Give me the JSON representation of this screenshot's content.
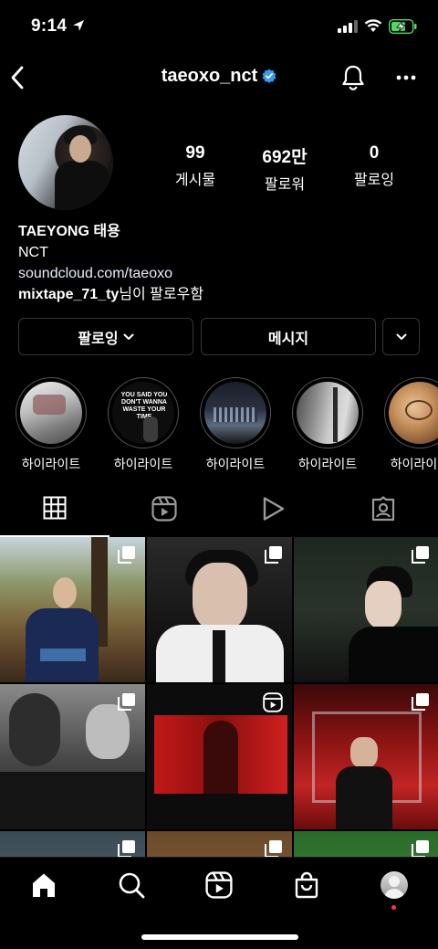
{
  "status": {
    "time": "9:14"
  },
  "header": {
    "username": "taeoxo_nct"
  },
  "stats": [
    {
      "value": "99",
      "label": "게시물"
    },
    {
      "value": "692만",
      "label": "팔로워"
    },
    {
      "value": "0",
      "label": "팔로잉"
    }
  ],
  "bio": {
    "name": "TAEYONG 태용",
    "line2": "NCT",
    "link": "soundcloud.com/taeoxo",
    "followed_user": "mixtape_71_ty",
    "followed_suffix": "님이 팔로우함"
  },
  "buttons": {
    "following": "팔로잉",
    "message": "메시지"
  },
  "highlights": [
    {
      "label": "하이라이트",
      "text": ""
    },
    {
      "label": "하이라이트",
      "text": "YOU SAID YOU DON'T WANNA WASTE YOUR TIME"
    },
    {
      "label": "하이라이트",
      "text": ""
    },
    {
      "label": "하이라이트",
      "text": ""
    },
    {
      "label": "하이라이트",
      "text": ""
    }
  ],
  "tabs": [
    {
      "icon": "grid-icon",
      "active": true
    },
    {
      "icon": "reels-icon",
      "active": false
    },
    {
      "icon": "play-icon",
      "active": false
    },
    {
      "icon": "tagged-icon",
      "active": false
    }
  ],
  "posts": [
    {
      "type": "carousel",
      "tone": "autumn-park"
    },
    {
      "type": "carousel",
      "tone": "dark-portrait"
    },
    {
      "type": "carousel",
      "tone": "dark-night"
    },
    {
      "type": "carousel",
      "tone": "bw-duo"
    },
    {
      "type": "reel",
      "tone": "red-screen"
    },
    {
      "type": "carousel",
      "tone": "red-stage"
    },
    {
      "type": "carousel",
      "tone": "gray"
    },
    {
      "type": "carousel",
      "tone": "warm"
    },
    {
      "type": "carousel",
      "tone": "green"
    }
  ],
  "nav": [
    "home-icon",
    "search-icon",
    "reels-icon",
    "shop-icon",
    "profile-avatar"
  ],
  "colors": {
    "background": "#000000",
    "verified": "#3897f0",
    "battery": "#4cd964",
    "notification_dot": "#ff3040"
  }
}
